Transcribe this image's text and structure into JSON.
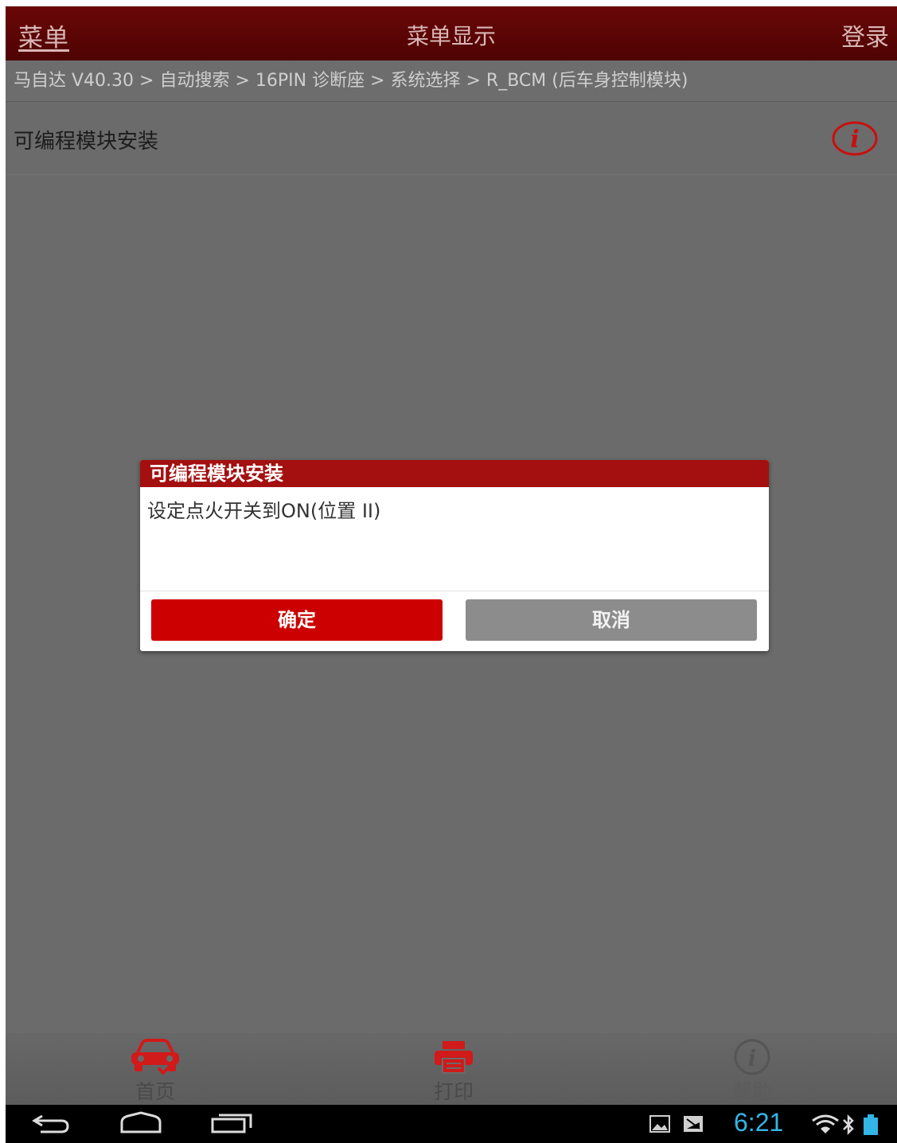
{
  "header": {
    "menu_label": "菜单",
    "title": "菜单显示",
    "login_label": "登录"
  },
  "breadcrumb": {
    "text": "马自达 V40.30 > 自动搜索 > 16PIN 诊断座 > 系统选择 > R_BCM (后车身控制模块)"
  },
  "function": {
    "title": "可编程模块安装",
    "info_icon": "info-circle-icon"
  },
  "dialog": {
    "title": "可编程模块安装",
    "message": "设定点火开关到ON(位置 II)",
    "ok_label": "确定",
    "cancel_label": "取消"
  },
  "toolbar": {
    "items": [
      {
        "label": "首页",
        "icon": "car-home-icon"
      },
      {
        "label": "打印",
        "icon": "printer-icon"
      },
      {
        "label": "帮助",
        "icon": "help-info-icon"
      }
    ]
  },
  "statusbar": {
    "time": "6:21"
  },
  "colors": {
    "title_bar": "#5a0505",
    "dialog_header": "#a40f10",
    "ok_button": "#cc0000",
    "cancel_button": "#8c8c8c",
    "clock": "#33b5e5"
  }
}
